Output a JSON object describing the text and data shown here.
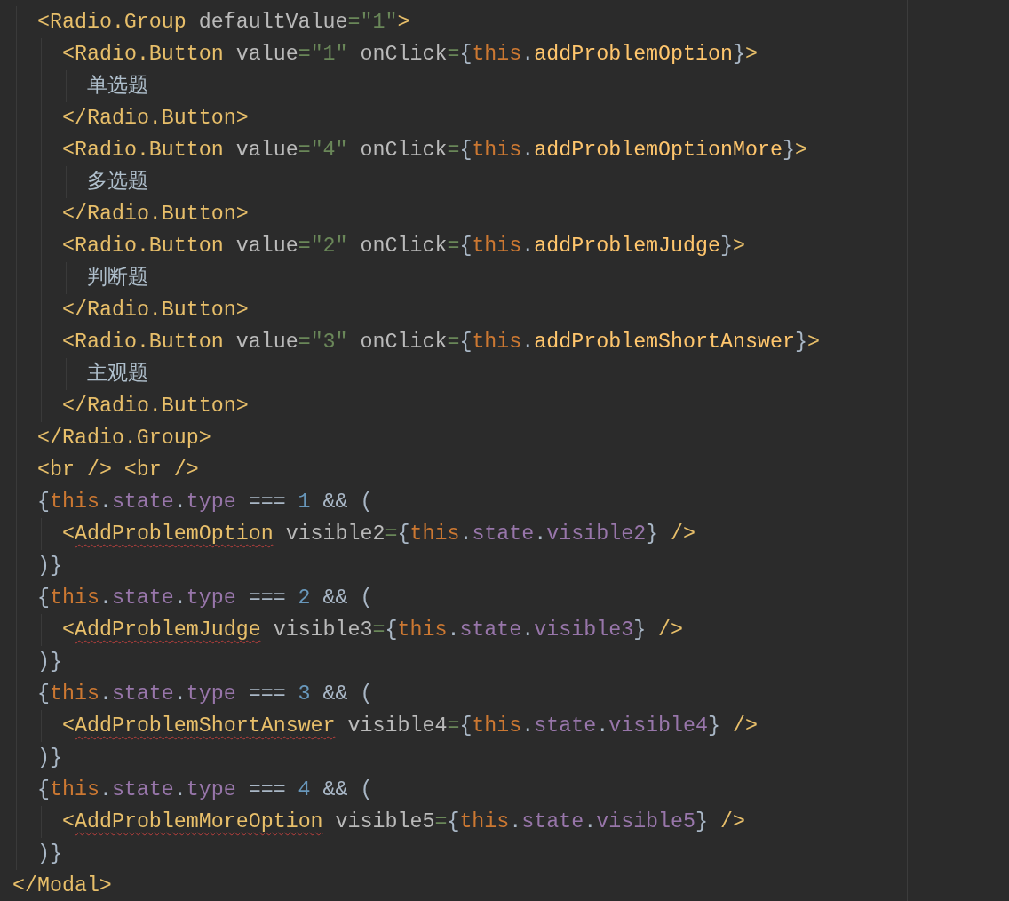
{
  "code_lines": [
    {
      "tokens": [
        {
          "kind": "tag",
          "text": "<Radio.Group"
        },
        {
          "kind": "attr",
          "text": " defaultValue"
        },
        {
          "kind": "eq",
          "text": "="
        },
        {
          "kind": "str",
          "text": "\"1\""
        },
        {
          "kind": "tag",
          "text": ">"
        }
      ],
      "children": [
        {
          "tokens": [
            {
              "kind": "tag",
              "text": "<Radio.Button"
            },
            {
              "kind": "attr",
              "text": " value"
            },
            {
              "kind": "eq",
              "text": "="
            },
            {
              "kind": "str",
              "text": "\"1\""
            },
            {
              "kind": "attr",
              "text": " onClick"
            },
            {
              "kind": "eq",
              "text": "="
            },
            {
              "kind": "brace",
              "text": "{"
            },
            {
              "kind": "kw",
              "text": "this"
            },
            {
              "kind": "dot",
              "text": "."
            },
            {
              "kind": "fn",
              "text": "addProblemOption"
            },
            {
              "kind": "brace",
              "text": "}"
            },
            {
              "kind": "tag",
              "text": ">"
            }
          ],
          "children": [
            {
              "tokens": [
                {
                  "kind": "text",
                  "text": "单选题"
                }
              ]
            }
          ]
        },
        {
          "tokens": [
            {
              "kind": "tag",
              "text": "</Radio.Button>"
            }
          ]
        },
        {
          "tokens": [
            {
              "kind": "tag",
              "text": "<Radio.Button"
            },
            {
              "kind": "attr",
              "text": " value"
            },
            {
              "kind": "eq",
              "text": "="
            },
            {
              "kind": "str",
              "text": "\"4\""
            },
            {
              "kind": "attr",
              "text": " onClick"
            },
            {
              "kind": "eq",
              "text": "="
            },
            {
              "kind": "brace",
              "text": "{"
            },
            {
              "kind": "kw",
              "text": "this"
            },
            {
              "kind": "dot",
              "text": "."
            },
            {
              "kind": "fn",
              "text": "addProblemOptionMore"
            },
            {
              "kind": "brace",
              "text": "}"
            },
            {
              "kind": "tag",
              "text": ">"
            }
          ],
          "children": [
            {
              "tokens": [
                {
                  "kind": "text",
                  "text": "多选题"
                }
              ]
            }
          ]
        },
        {
          "tokens": [
            {
              "kind": "tag",
              "text": "</Radio.Button>"
            }
          ]
        },
        {
          "tokens": [
            {
              "kind": "tag",
              "text": "<Radio.Button"
            },
            {
              "kind": "attr",
              "text": " value"
            },
            {
              "kind": "eq",
              "text": "="
            },
            {
              "kind": "str",
              "text": "\"2\""
            },
            {
              "kind": "attr",
              "text": " onClick"
            },
            {
              "kind": "eq",
              "text": "="
            },
            {
              "kind": "brace",
              "text": "{"
            },
            {
              "kind": "kw",
              "text": "this"
            },
            {
              "kind": "dot",
              "text": "."
            },
            {
              "kind": "fn",
              "text": "addProblemJudge"
            },
            {
              "kind": "brace",
              "text": "}"
            },
            {
              "kind": "tag",
              "text": ">"
            }
          ],
          "children": [
            {
              "tokens": [
                {
                  "kind": "text",
                  "text": "判断题"
                }
              ]
            }
          ]
        },
        {
          "tokens": [
            {
              "kind": "tag",
              "text": "</Radio.Button>"
            }
          ]
        },
        {
          "tokens": [
            {
              "kind": "tag",
              "text": "<Radio.Button"
            },
            {
              "kind": "attr",
              "text": " value"
            },
            {
              "kind": "eq",
              "text": "="
            },
            {
              "kind": "str",
              "text": "\"3\""
            },
            {
              "kind": "attr",
              "text": " onClick"
            },
            {
              "kind": "eq",
              "text": "="
            },
            {
              "kind": "brace",
              "text": "{"
            },
            {
              "kind": "kw",
              "text": "this"
            },
            {
              "kind": "dot",
              "text": "."
            },
            {
              "kind": "fn",
              "text": "addProblemShortAnswer"
            },
            {
              "kind": "brace",
              "text": "}"
            },
            {
              "kind": "tag",
              "text": ">"
            }
          ],
          "children": [
            {
              "tokens": [
                {
                  "kind": "text",
                  "text": "主观题"
                }
              ]
            }
          ]
        },
        {
          "tokens": [
            {
              "kind": "tag",
              "text": "</Radio.Button>"
            }
          ]
        }
      ]
    },
    {
      "tokens": [
        {
          "kind": "tag",
          "text": "</Radio.Group>"
        }
      ]
    },
    {
      "tokens": [
        {
          "kind": "tag",
          "text": "<br /> <br />"
        }
      ]
    },
    {
      "tokens": [
        {
          "kind": "brace",
          "text": "{"
        },
        {
          "kind": "kw",
          "text": "this"
        },
        {
          "kind": "dot",
          "text": "."
        },
        {
          "kind": "prop",
          "text": "state"
        },
        {
          "kind": "dot",
          "text": "."
        },
        {
          "kind": "prop",
          "text": "type"
        },
        {
          "kind": "op",
          "text": " === "
        },
        {
          "kind": "num",
          "text": "1"
        },
        {
          "kind": "op",
          "text": " && ("
        }
      ],
      "children": [
        {
          "tokens": [
            {
              "kind": "tag",
              "text": "<"
            },
            {
              "kind": "tag",
              "text": "AddProblemOption",
              "error": true
            },
            {
              "kind": "attr",
              "text": " visible2"
            },
            {
              "kind": "eq",
              "text": "="
            },
            {
              "kind": "brace",
              "text": "{"
            },
            {
              "kind": "kw",
              "text": "this"
            },
            {
              "kind": "dot",
              "text": "."
            },
            {
              "kind": "prop",
              "text": "state"
            },
            {
              "kind": "dot",
              "text": "."
            },
            {
              "kind": "prop",
              "text": "visible2"
            },
            {
              "kind": "brace",
              "text": "}"
            },
            {
              "kind": "tag",
              "text": " />"
            }
          ]
        }
      ]
    },
    {
      "tokens": [
        {
          "kind": "brace",
          "text": ")}"
        }
      ]
    },
    {
      "tokens": [
        {
          "kind": "brace",
          "text": "{"
        },
        {
          "kind": "kw",
          "text": "this"
        },
        {
          "kind": "dot",
          "text": "."
        },
        {
          "kind": "prop",
          "text": "state"
        },
        {
          "kind": "dot",
          "text": "."
        },
        {
          "kind": "prop",
          "text": "type"
        },
        {
          "kind": "op",
          "text": " === "
        },
        {
          "kind": "num",
          "text": "2"
        },
        {
          "kind": "op",
          "text": " && ("
        }
      ],
      "children": [
        {
          "tokens": [
            {
              "kind": "tag",
              "text": "<"
            },
            {
              "kind": "tag",
              "text": "AddProblemJudge",
              "error": true
            },
            {
              "kind": "attr",
              "text": " visible3"
            },
            {
              "kind": "eq",
              "text": "="
            },
            {
              "kind": "brace",
              "text": "{"
            },
            {
              "kind": "kw",
              "text": "this"
            },
            {
              "kind": "dot",
              "text": "."
            },
            {
              "kind": "prop",
              "text": "state"
            },
            {
              "kind": "dot",
              "text": "."
            },
            {
              "kind": "prop",
              "text": "visible3"
            },
            {
              "kind": "brace",
              "text": "}"
            },
            {
              "kind": "tag",
              "text": " />"
            }
          ]
        }
      ]
    },
    {
      "tokens": [
        {
          "kind": "brace",
          "text": ")}"
        }
      ]
    },
    {
      "tokens": [
        {
          "kind": "brace",
          "text": "{"
        },
        {
          "kind": "kw",
          "text": "this"
        },
        {
          "kind": "dot",
          "text": "."
        },
        {
          "kind": "prop",
          "text": "state"
        },
        {
          "kind": "dot",
          "text": "."
        },
        {
          "kind": "prop",
          "text": "type"
        },
        {
          "kind": "op",
          "text": " === "
        },
        {
          "kind": "num",
          "text": "3"
        },
        {
          "kind": "op",
          "text": " && ("
        }
      ],
      "children": [
        {
          "tokens": [
            {
              "kind": "tag",
              "text": "<"
            },
            {
              "kind": "tag",
              "text": "AddProblemShortAnswer",
              "error": true
            },
            {
              "kind": "attr",
              "text": " visible4"
            },
            {
              "kind": "eq",
              "text": "="
            },
            {
              "kind": "brace",
              "text": "{"
            },
            {
              "kind": "kw",
              "text": "this"
            },
            {
              "kind": "dot",
              "text": "."
            },
            {
              "kind": "prop",
              "text": "state"
            },
            {
              "kind": "dot",
              "text": "."
            },
            {
              "kind": "prop",
              "text": "visible4"
            },
            {
              "kind": "brace",
              "text": "}"
            },
            {
              "kind": "tag",
              "text": " />"
            }
          ]
        }
      ]
    },
    {
      "tokens": [
        {
          "kind": "brace",
          "text": ")}"
        }
      ]
    },
    {
      "tokens": [
        {
          "kind": "brace",
          "text": "{"
        },
        {
          "kind": "kw",
          "text": "this"
        },
        {
          "kind": "dot",
          "text": "."
        },
        {
          "kind": "prop",
          "text": "state"
        },
        {
          "kind": "dot",
          "text": "."
        },
        {
          "kind": "prop",
          "text": "type"
        },
        {
          "kind": "op",
          "text": " === "
        },
        {
          "kind": "num",
          "text": "4"
        },
        {
          "kind": "op",
          "text": " && ("
        }
      ],
      "children": [
        {
          "tokens": [
            {
              "kind": "tag",
              "text": "<"
            },
            {
              "kind": "tag",
              "text": "AddProblemMoreOption",
              "error": true
            },
            {
              "kind": "attr",
              "text": " visible5"
            },
            {
              "kind": "eq",
              "text": "="
            },
            {
              "kind": "brace",
              "text": "{"
            },
            {
              "kind": "kw",
              "text": "this"
            },
            {
              "kind": "dot",
              "text": "."
            },
            {
              "kind": "prop",
              "text": "state"
            },
            {
              "kind": "dot",
              "text": "."
            },
            {
              "kind": "prop",
              "text": "visible5"
            },
            {
              "kind": "brace",
              "text": "}"
            },
            {
              "kind": "tag",
              "text": " />"
            }
          ]
        }
      ]
    },
    {
      "tokens": [
        {
          "kind": "brace",
          "text": ")}"
        }
      ]
    }
  ],
  "closing_line": {
    "tokens": [
      {
        "kind": "tag",
        "text": "</Modal>"
      }
    ]
  }
}
